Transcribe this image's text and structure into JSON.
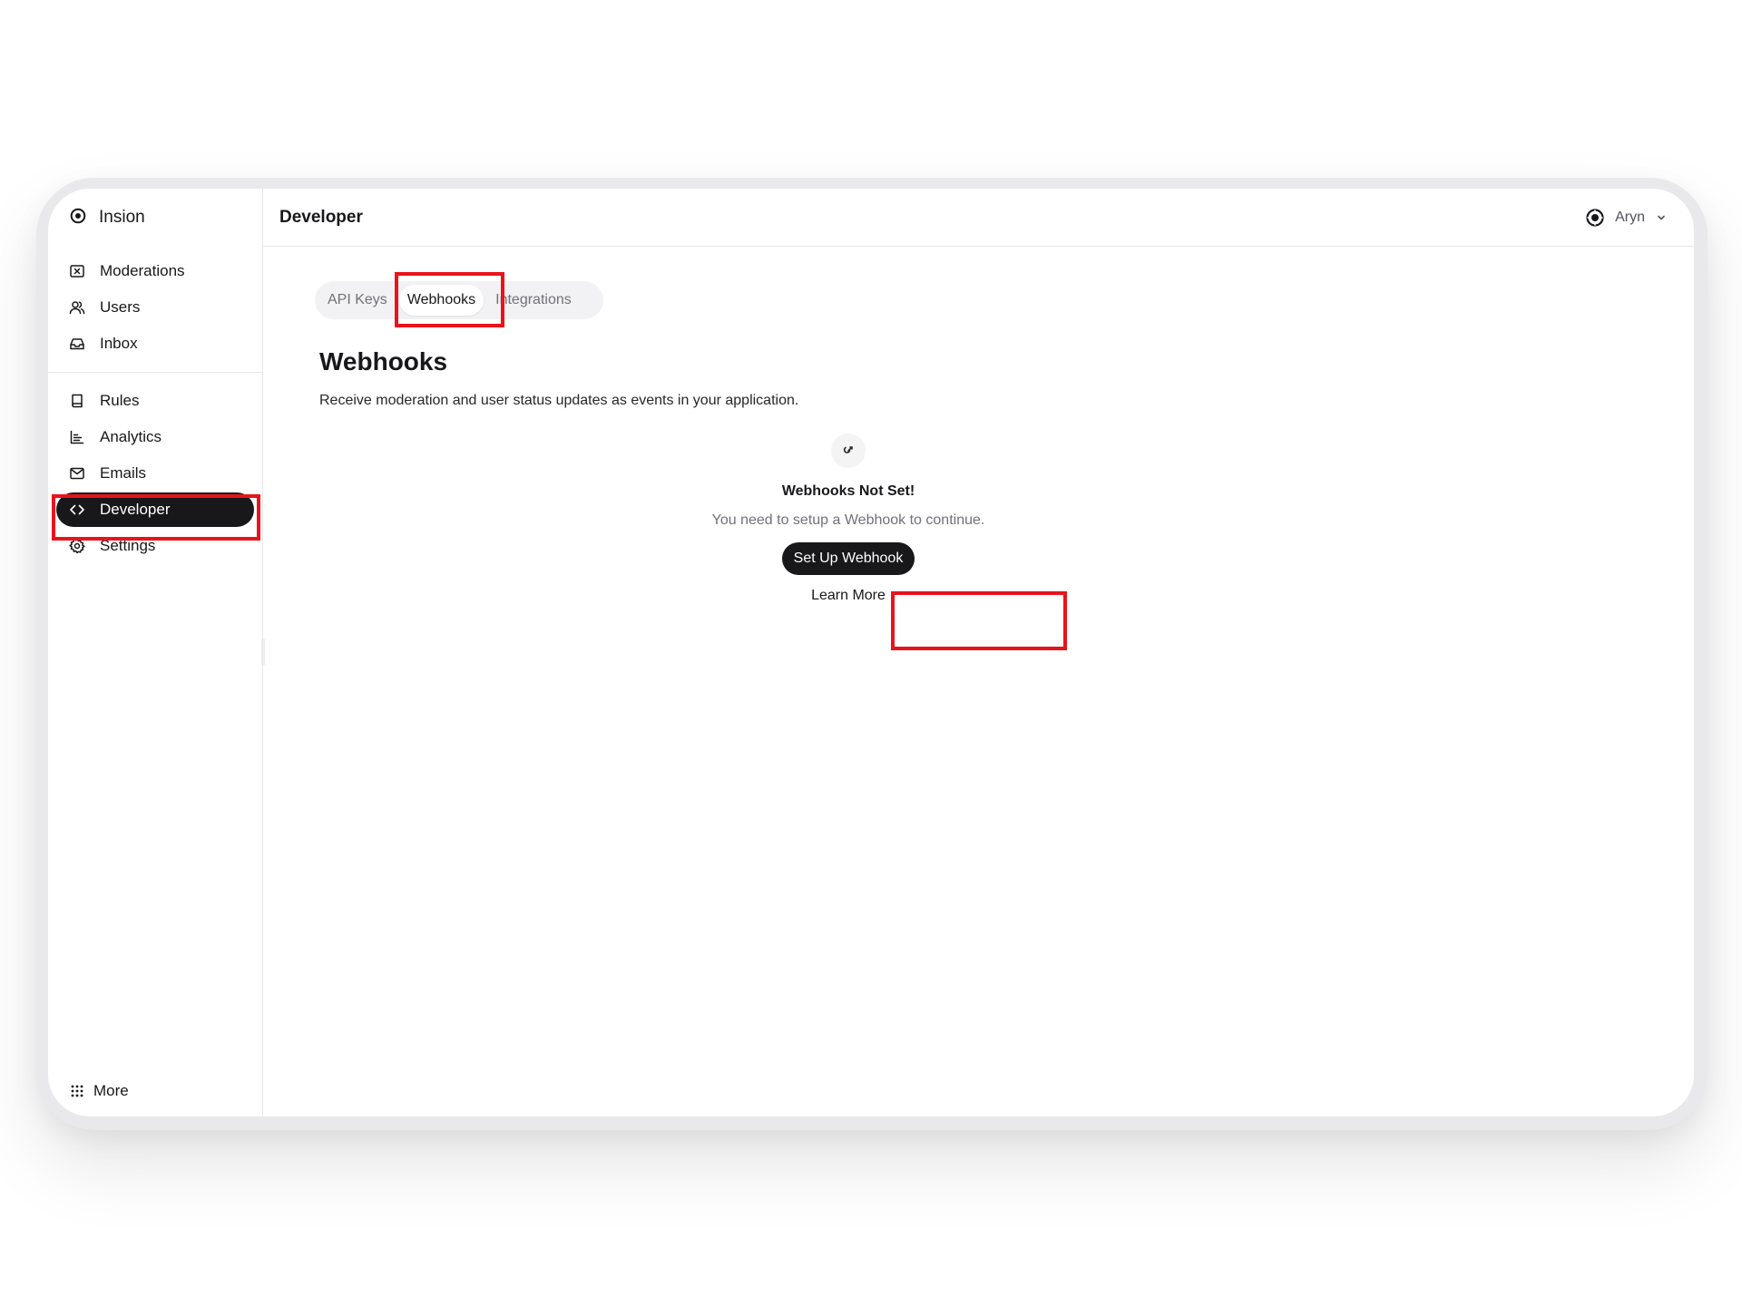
{
  "sidebar": {
    "brand": "Insion",
    "groups": [
      [
        {
          "label": "Moderations",
          "icon": "moderation-icon"
        },
        {
          "label": "Users",
          "icon": "users-icon"
        },
        {
          "label": "Inbox",
          "icon": "inbox-icon"
        }
      ],
      [
        {
          "label": "Rules",
          "icon": "book-icon"
        },
        {
          "label": "Analytics",
          "icon": "bar-chart-icon"
        },
        {
          "label": "Emails",
          "icon": "mail-icon"
        },
        {
          "label": "Developer",
          "icon": "code-icon",
          "active": true
        },
        {
          "label": "Settings",
          "icon": "gear-icon"
        }
      ]
    ],
    "more": "More"
  },
  "topbar": {
    "title": "Developer",
    "user": "Aryn"
  },
  "tabs": [
    {
      "label": "API Keys"
    },
    {
      "label": "Webhooks",
      "active": true
    },
    {
      "label": "Integrations"
    }
  ],
  "section": {
    "title": "Webhooks",
    "description": "Receive moderation and user status updates as events in your application."
  },
  "empty_state": {
    "title": "Webhooks Not Set!",
    "description": "You need to setup a Webhook to continue.",
    "primary_button": "Set Up Webhook",
    "secondary_link": "Learn More"
  },
  "colors": {
    "accent": "#18181b",
    "highlight": "#e8131b"
  }
}
